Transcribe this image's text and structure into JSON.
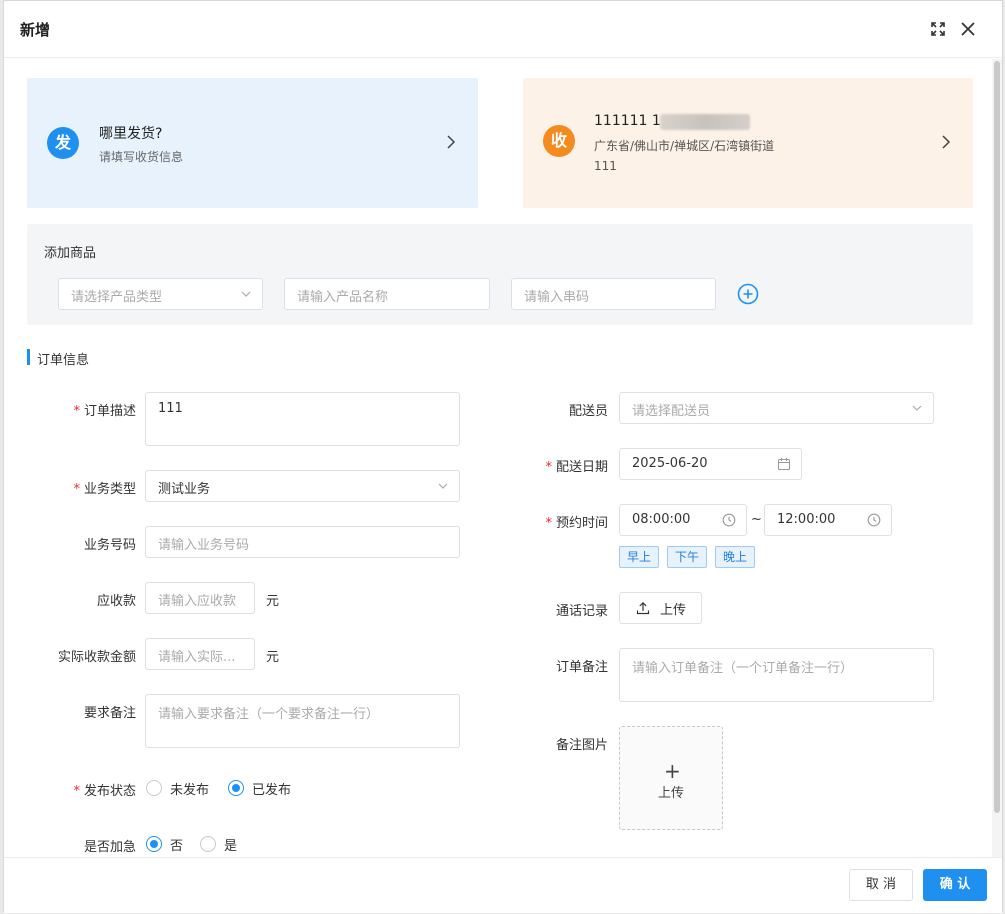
{
  "dialog": {
    "title": "新增"
  },
  "sender": {
    "badge": "发",
    "title": "哪里发货?",
    "subtitle": "请填写收货信息"
  },
  "receiver": {
    "badge": "收",
    "name": "111111  1",
    "address": "广东省/佛山市/禅城区/石湾镇街道",
    "detail": "111"
  },
  "goods": {
    "title": "添加商品",
    "type_placeholder": "请选择产品类型",
    "name_placeholder": "请输入产品名称",
    "serial_placeholder": "请输入串码"
  },
  "section": {
    "title": "订单信息"
  },
  "form_left": {
    "desc": {
      "label": "订单描述",
      "value": "111"
    },
    "biz_type": {
      "label": "业务类型",
      "value": "测试业务"
    },
    "biz_no": {
      "label": "业务号码",
      "placeholder": "请输入业务号码"
    },
    "receivable": {
      "label": "应收款",
      "placeholder": "请输入应收款",
      "unit": "元"
    },
    "actual": {
      "label": "实际收款金额",
      "placeholder": "请输入实际...",
      "unit": "元"
    },
    "req_note": {
      "label": "要求备注",
      "placeholder": "请输入要求备注（一个要求备注一行）"
    },
    "publish": {
      "label": "发布状态",
      "options": [
        "未发布",
        "已发布"
      ],
      "selected": "已发布"
    },
    "urgent": {
      "label": "是否加急",
      "options": [
        "否",
        "是"
      ],
      "selected": "否"
    }
  },
  "form_right": {
    "courier": {
      "label": "配送员",
      "placeholder": "请选择配送员"
    },
    "date": {
      "label": "配送日期",
      "value": "2025-06-20"
    },
    "time": {
      "label": "预约时间",
      "start": "08:00:00",
      "separator": "~",
      "end": "12:00:00",
      "presets": [
        "早上",
        "下午",
        "晚上"
      ]
    },
    "call": {
      "label": "通话记录",
      "button": "上传"
    },
    "order_note": {
      "label": "订单备注",
      "placeholder": "请输入订单备注（一个订单备注一行）"
    },
    "image": {
      "label": "备注图片",
      "plus": "+",
      "button": "上传"
    }
  },
  "footer": {
    "cancel": "取 消",
    "confirm": "确 认"
  },
  "colors": {
    "primary": "#1f8ff0",
    "orange": "#f58a1f",
    "required": "#f5222d"
  }
}
